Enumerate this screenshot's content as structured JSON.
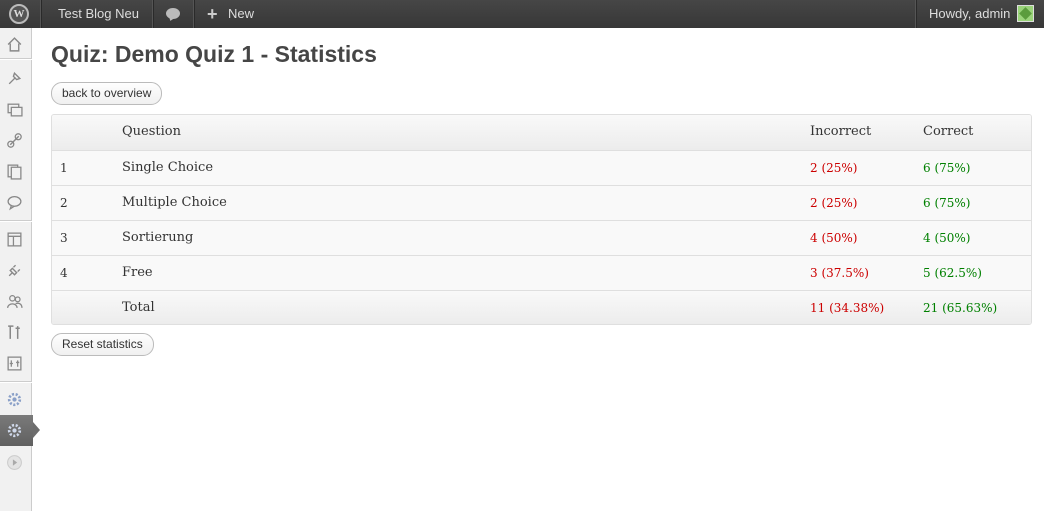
{
  "adminbar": {
    "site_name": "Test Blog Neu",
    "new_label": "New",
    "greeting": "Howdy, admin",
    "icons": [
      "wordpress-logo-icon",
      "comments-icon",
      "plus-icon",
      "avatar"
    ]
  },
  "sidebar": {
    "icons": [
      "dashboard-icon",
      "posts-icon",
      "media-icon",
      "links-icon",
      "pages-icon",
      "comments-icon",
      "appearance-icon",
      "plugins-icon",
      "users-icon",
      "tools-icon",
      "settings-icon",
      "quiz-settings-icon",
      "quiz-icon",
      "collapse-icon"
    ]
  },
  "page": {
    "title": "Quiz: Demo Quiz 1 - Statistics",
    "back_button": "back to overview",
    "reset_button": "Reset statistics"
  },
  "table": {
    "headers": {
      "number": "",
      "question": "Question",
      "incorrect": "Incorrect",
      "correct": "Correct"
    },
    "rows": [
      {
        "number": "1",
        "question": "Single Choice",
        "incorrect": "2 (25%)",
        "correct": "6 (75%)"
      },
      {
        "number": "2",
        "question": "Multiple Choice",
        "incorrect": "2 (25%)",
        "correct": "6 (75%)"
      },
      {
        "number": "3",
        "question": "Sortierung",
        "incorrect": "4 (50%)",
        "correct": "4 (50%)"
      },
      {
        "number": "4",
        "question": "Free",
        "incorrect": "3 (37.5%)",
        "correct": "5 (62.5%)"
      }
    ],
    "total": {
      "label": "Total",
      "incorrect": "11 (34.38%)",
      "correct": "21 (65.63%)"
    }
  },
  "colors": {
    "incorrect": "#cc0000",
    "correct": "#008000",
    "adminbar": "#464646"
  }
}
